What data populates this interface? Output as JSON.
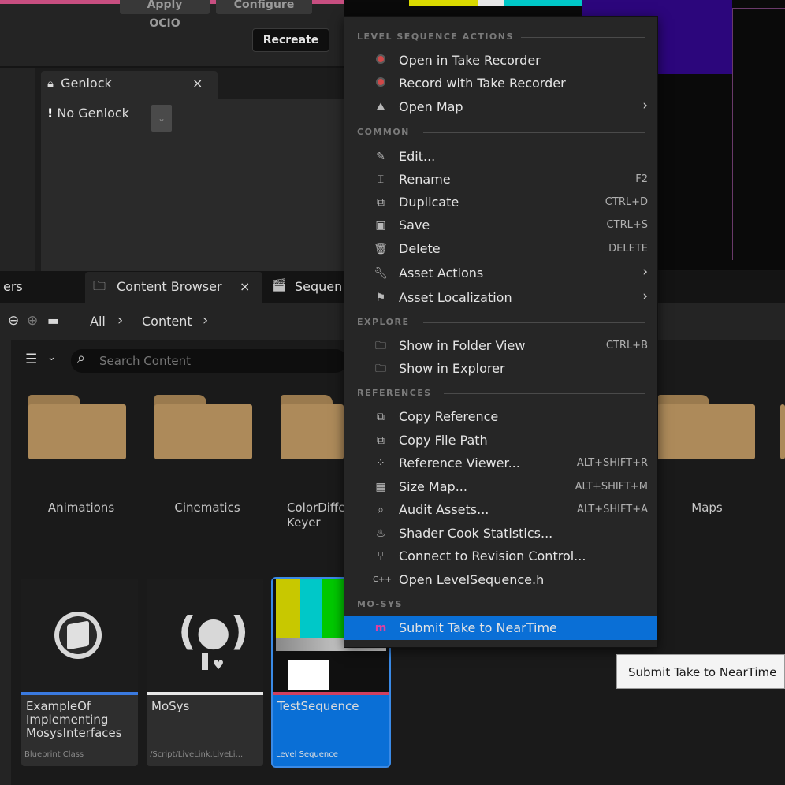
{
  "top": {
    "apply_ocio": "Apply OCIO",
    "configure": "Configure",
    "recreate": "Recreate"
  },
  "genlock": {
    "tab_label": "Genlock",
    "close": "×",
    "status": "No Genlock"
  },
  "tabs": {
    "left_partial": "ers",
    "content_browser": "Content Browser",
    "close": "×",
    "sequencer_partial": "Sequen"
  },
  "path": {
    "all": "All",
    "sep": "›",
    "content": "Content"
  },
  "search": {
    "placeholder": "Search Content"
  },
  "folders": [
    {
      "label": "Animations"
    },
    {
      "label": "Cinematics"
    },
    {
      "label": "ColorDiffe\nKeyer"
    },
    {
      "label": "Maps"
    }
  ],
  "assets": [
    {
      "name": "ExampleOf Implementing MosysInterfaces",
      "type": "Blueprint Class",
      "bar_color": "#3a7ae0"
    },
    {
      "name": "MoSys",
      "type": "/Script/LiveLink.LiveLi...",
      "bar_color": "#e8e8e8"
    },
    {
      "name": "TestSequence",
      "type": "Level Sequence",
      "bar_color": "#d04060"
    }
  ],
  "menu": {
    "sections": {
      "level_sequence": "LEVEL SEQUENCE ACTIONS",
      "common": "COMMON",
      "explore": "EXPLORE",
      "references": "REFERENCES",
      "mosys": "MO-SYS"
    },
    "items": {
      "open_take_recorder": "Open in Take Recorder",
      "record_take_recorder": "Record with Take Recorder",
      "open_map": "Open Map",
      "edit": "Edit...",
      "rename": "Rename",
      "rename_sc": "F2",
      "duplicate": "Duplicate",
      "duplicate_sc": "CTRL+D",
      "save": "Save",
      "save_sc": "CTRL+S",
      "delete": "Delete",
      "delete_sc": "DELETE",
      "asset_actions": "Asset Actions",
      "asset_localization": "Asset Localization",
      "show_folder_view": "Show in Folder View",
      "show_folder_view_sc": "CTRL+B",
      "show_explorer": "Show in Explorer",
      "copy_reference": "Copy Reference",
      "copy_file_path": "Copy File Path",
      "reference_viewer": "Reference Viewer...",
      "reference_viewer_sc": "ALT+SHIFT+R",
      "size_map": "Size Map...",
      "size_map_sc": "ALT+SHIFT+M",
      "audit_assets": "Audit Assets...",
      "audit_assets_sc": "ALT+SHIFT+A",
      "shader_cook": "Shader Cook Statistics...",
      "connect_revision": "Connect to Revision Control...",
      "open_header": "Open LevelSequence.h",
      "submit_take": "Submit Take to NearTime"
    },
    "arrow": "›"
  },
  "tooltip": "Submit Take to NearTime",
  "colors": {
    "highlight": "#0a6fd6",
    "folder": "#ad8a5a",
    "selected_card": "#0a6fd6"
  }
}
